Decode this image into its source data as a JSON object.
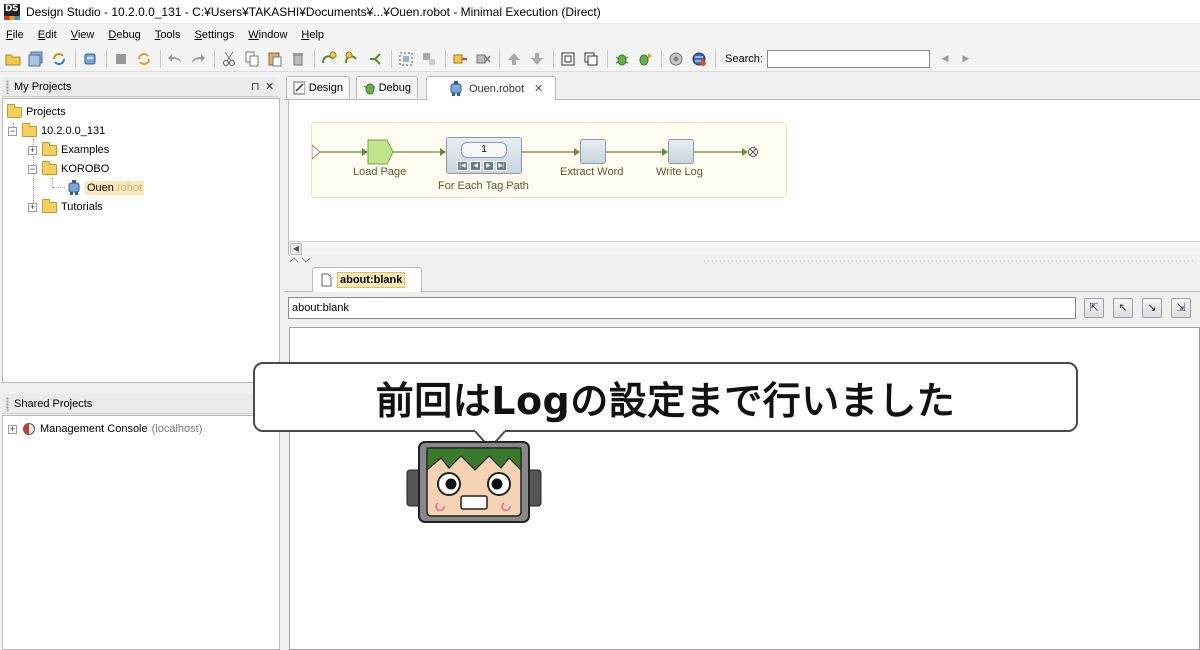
{
  "window": {
    "logo": "DS",
    "title": "Design Studio - 10.2.0.0_131 - C:¥Users¥TAKASHI¥Documents¥...¥Ouen.robot - Minimal Execution (Direct)"
  },
  "menu": [
    {
      "label": "File",
      "key": "F"
    },
    {
      "label": "Edit",
      "key": "E"
    },
    {
      "label": "View",
      "key": "V"
    },
    {
      "label": "Debug",
      "key": "D"
    },
    {
      "label": "Tools",
      "key": "T"
    },
    {
      "label": "Settings",
      "key": "S"
    },
    {
      "label": "Window",
      "key": "W"
    },
    {
      "label": "Help",
      "key": "H"
    }
  ],
  "toolbar": {
    "search_label": "Search:",
    "search_value": "",
    "prev_arrow": "◀",
    "next_arrow": "▶"
  },
  "my_projects": {
    "title": "My Projects",
    "pin": "⊓",
    "close": "✕",
    "tree": {
      "root": "Projects",
      "version_folder": "10.2.0.0_131",
      "examples": "Examples",
      "korobo": "KOROBO",
      "robot_name": "Ouen",
      "robot_ext": ".robot",
      "tutorials": "Tutorials"
    }
  },
  "shared_projects": {
    "title": "Shared Projects",
    "item_name": "Management Console",
    "item_host": "(localhost)"
  },
  "editor_tabs": [
    {
      "label": "Design"
    },
    {
      "label": "Debug"
    },
    {
      "label": "Ouen.robot",
      "close": "✕"
    }
  ],
  "flow": {
    "steps": [
      {
        "label": "Load Page"
      },
      {
        "label": "For Each Tag Path",
        "counter": "1"
      },
      {
        "label": "Extract Word"
      },
      {
        "label": "Write Log"
      }
    ]
  },
  "browser": {
    "tab_label": "about:blank",
    "url": "about:blank"
  },
  "overlay": {
    "bubble_text": "前回はLogの設定まで行いました"
  },
  "colors": {
    "accent": "#fbe9b9",
    "flow_line": "#6a8a3a",
    "load_page_fill": "#bfe48a"
  }
}
